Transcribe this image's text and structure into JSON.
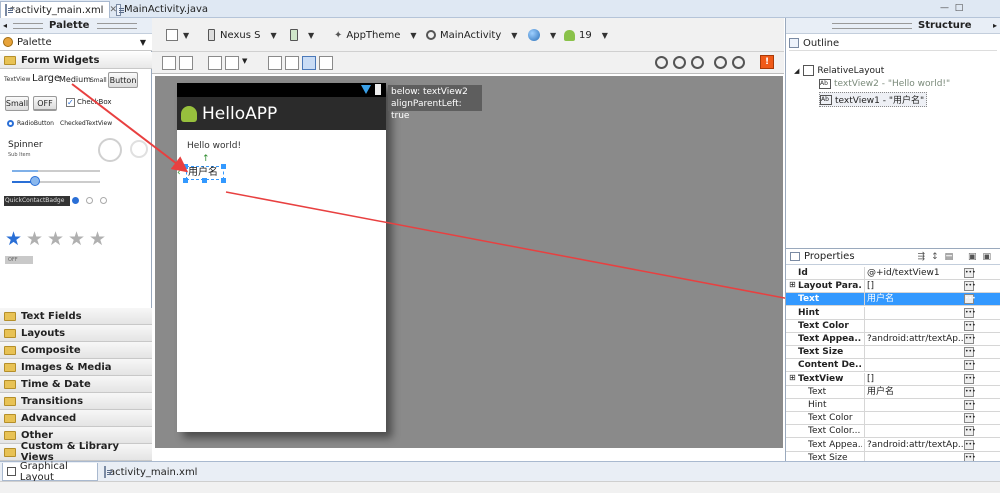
{
  "editor_tabs": [
    {
      "label": "*activity_main.xml",
      "active": true
    },
    {
      "label": "MainActivity.java",
      "active": false
    }
  ],
  "palette": {
    "title": "Palette",
    "dropdown_label": "Palette",
    "expanded_category": "Form Widgets",
    "widgets": {
      "textview_label": "TextView",
      "large_label": "Large",
      "medium_label": "Medium",
      "small_label": "Small",
      "button_label": "Button",
      "small_button_label": "Small",
      "toggle_label": "OFF",
      "checkbox_label": "CheckBox",
      "radio_label": "RadioButton",
      "checked_textview_label": "CheckedTextView",
      "spinner_label": "Spinner",
      "spinner_sub": "Sub Item",
      "quickcontact_label": "QuickContactBadge",
      "switch_label": "OFF"
    },
    "categories": [
      "Text Fields",
      "Layouts",
      "Composite",
      "Images & Media",
      "Time & Date",
      "Transitions",
      "Advanced",
      "Other",
      "Custom & Library Views"
    ]
  },
  "toolbar": {
    "device": "Nexus S",
    "theme": "AppTheme",
    "activity": "MainActivity",
    "api_level": "19",
    "warning_icon": "warning-icon"
  },
  "device_preview": {
    "app_title": "HelloAPP",
    "hello_text": "Hello world!",
    "username_text": "用户名"
  },
  "tooltip": {
    "line1": "below: textView2",
    "line2": "alignParentLeft: true"
  },
  "structure": {
    "title": "Structure",
    "outline_title": "Outline",
    "root": "RelativeLayout",
    "children": [
      "textView2 - \"Hello world!\"",
      "textView1 - \"用户名\""
    ]
  },
  "properties": {
    "title": "Properties",
    "rows": [
      {
        "name": "Id",
        "value": "@+id/textView1",
        "selected": false
      },
      {
        "name": "Layout Para...",
        "value": "[]",
        "selected": false
      },
      {
        "name": "Text",
        "value": "用户名",
        "selected": true
      },
      {
        "name": "Hint",
        "value": "",
        "selected": false
      },
      {
        "name": "Text Color",
        "value": "",
        "selected": false
      },
      {
        "name": "Text Appea...",
        "value": "?android:attr/textAp...",
        "selected": false
      },
      {
        "name": "Text Size",
        "value": "",
        "selected": false
      },
      {
        "name": "Content De...",
        "value": "",
        "selected": false
      },
      {
        "name": "TextView",
        "value": "[]",
        "selected": false
      },
      {
        "name": "Text",
        "value": "用户名",
        "selected": false
      },
      {
        "name": "Hint",
        "value": "",
        "selected": false
      },
      {
        "name": "Text Color",
        "value": "",
        "selected": false
      },
      {
        "name": "Text Color...",
        "value": "",
        "selected": false
      },
      {
        "name": "Text Appea...",
        "value": "?android:attr/textAp...",
        "selected": false
      },
      {
        "name": "Text Size",
        "value": "",
        "selected": false
      }
    ]
  },
  "bottom_tabs": [
    {
      "label": "Graphical Layout",
      "active": true
    },
    {
      "label": "activity_main.xml",
      "active": false
    }
  ],
  "colors": {
    "selection": "#3399ff",
    "annotation_arrow": "#e84040",
    "actionbar": "#2b2b2b"
  }
}
